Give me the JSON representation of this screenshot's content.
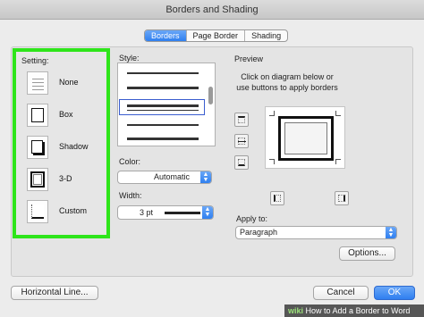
{
  "window": {
    "title": "Borders and Shading"
  },
  "tabs": [
    {
      "label": "Borders",
      "active": true
    },
    {
      "label": "Page Border",
      "active": false
    },
    {
      "label": "Shading",
      "active": false
    }
  ],
  "setting": {
    "label": "Setting:",
    "items": [
      {
        "label": "None",
        "icon": "border-none-icon"
      },
      {
        "label": "Box",
        "icon": "border-box-icon"
      },
      {
        "label": "Shadow",
        "icon": "border-shadow-icon"
      },
      {
        "label": "3-D",
        "icon": "border-3d-icon"
      },
      {
        "label": "Custom",
        "icon": "border-custom-icon"
      }
    ],
    "highlight_color": "#2ee51a"
  },
  "style": {
    "label": "Style:"
  },
  "color": {
    "label": "Color:",
    "value": "Automatic"
  },
  "width": {
    "label": "Width:",
    "value": "3 pt"
  },
  "preview": {
    "label": "Preview",
    "instructions": "Click on diagram below or use buttons to apply borders"
  },
  "apply_to": {
    "label": "Apply to:",
    "value": "Paragraph"
  },
  "buttons": {
    "options": "Options...",
    "horizontal_line": "Horizontal Line...",
    "cancel": "Cancel",
    "ok": "OK"
  },
  "watermark": {
    "brand": "wiki",
    "text": "How to Add a Border to Word"
  },
  "colors": {
    "accent": "#2f7ff0",
    "selection": "#3a5dcf"
  }
}
